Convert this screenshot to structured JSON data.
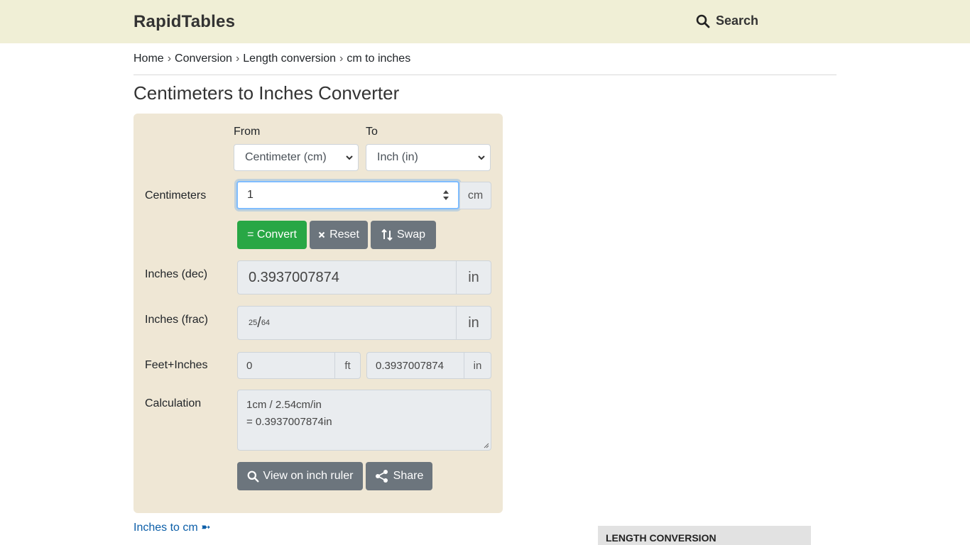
{
  "header": {
    "logo": "RapidTables",
    "search_label": "Search",
    "search_icon": "search-icon"
  },
  "breadcrumb": [
    "Home",
    "Conversion",
    "Length conversion",
    "cm to inches"
  ],
  "breadcrumb_separator": "›",
  "page_title": "Centimeters to Inches Converter",
  "converter": {
    "from_label": "From",
    "to_label": "To",
    "from_value": "Centimeter (cm)",
    "to_value": "Inch (in)",
    "input_label": "Centimeters",
    "input_value": "1",
    "input_unit": "cm",
    "buttons": {
      "convert": "= Convert",
      "reset": "Reset",
      "swap": "Swap"
    },
    "dec_label": "Inches (dec)",
    "dec_value": "0.3937007874",
    "dec_unit": "in",
    "frac_label": "Inches (frac)",
    "frac_numerator": "25",
    "frac_slash": "/",
    "frac_denominator": "64",
    "frac_unit": "in",
    "ftin_label": "Feet+Inches",
    "ft_value": "0",
    "ft_unit": "ft",
    "in_value": "0.3937007874",
    "in_unit": "in",
    "calc_label": "Calculation",
    "calc_line1": "1cm / 2.54cm/in",
    "calc_line2": "= 0.3937007874in",
    "ruler_button": "View on inch ruler",
    "share_button": "Share"
  },
  "link_inches_to_cm": "Inches to cm ➼",
  "sidebar_heading": "LENGTH CONVERSION",
  "colors": {
    "topbar": "#f0efd6",
    "panel": "#efe7d5",
    "convert_green": "#28a745",
    "button_gray": "#6c757d",
    "link": "#0b5ea8"
  }
}
